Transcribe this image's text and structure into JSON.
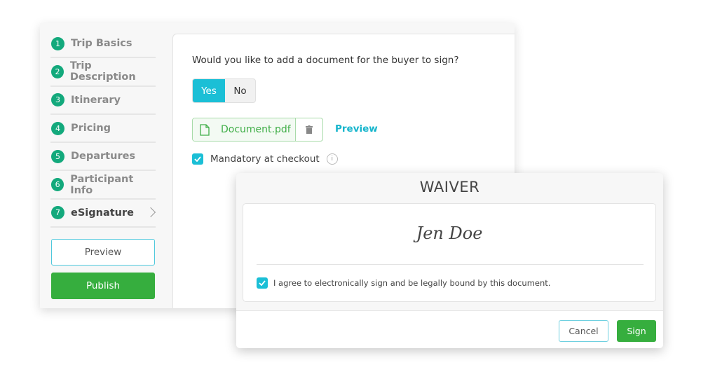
{
  "sidebar": {
    "steps": [
      {
        "num": "1",
        "label": "Trip Basics"
      },
      {
        "num": "2",
        "label": "Trip Description"
      },
      {
        "num": "3",
        "label": "Itinerary"
      },
      {
        "num": "4",
        "label": "Pricing"
      },
      {
        "num": "5",
        "label": "Departures"
      },
      {
        "num": "6",
        "label": "Participant Info"
      },
      {
        "num": "7",
        "label": "eSignature",
        "active": true
      }
    ],
    "preview_label": "Preview",
    "publish_label": "Publish"
  },
  "main": {
    "question": "Would you like to add a document for the buyer to sign?",
    "toggle": {
      "yes": "Yes",
      "no": "No",
      "selected": "Yes"
    },
    "document": {
      "name": "Document.pdf",
      "icon": "file-icon",
      "delete_icon": "trash-icon"
    },
    "preview_link": "Preview",
    "mandatory": {
      "label": "Mandatory at checkout",
      "checked": true,
      "info_icon": "i"
    }
  },
  "modal": {
    "title": "WAIVER",
    "signature": "Jen Doe",
    "agree_label": "I agree to electronically sign and be legally bound by this document.",
    "agree_checked": true,
    "cancel_label": "Cancel",
    "sign_label": "Sign"
  },
  "colors": {
    "accent": "#1bbfd6",
    "green": "#36ae3e",
    "step": "#13a97c"
  }
}
